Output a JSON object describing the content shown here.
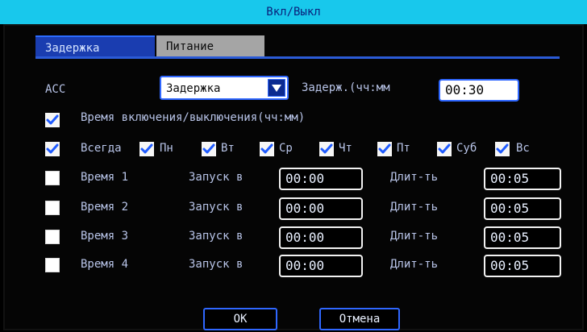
{
  "window": {
    "title": "Вкл/Выкл"
  },
  "tabs": [
    {
      "label": "Задержка"
    },
    {
      "label": "Питание"
    }
  ],
  "acc": {
    "label": "ACC",
    "dropdown_value": "Задержка",
    "delay_label": "Задерж.(чч:мм",
    "delay_value": "00:30"
  },
  "time_onoff": {
    "checked": true,
    "label": "Время включения/выключения(чч:мм)"
  },
  "days": [
    {
      "label": "Всегда",
      "checked": true
    },
    {
      "label": "Пн",
      "checked": true
    },
    {
      "label": "Вт",
      "checked": true
    },
    {
      "label": "Ср",
      "checked": true
    },
    {
      "label": "Чт",
      "checked": true
    },
    {
      "label": "Пт",
      "checked": true
    },
    {
      "label": "Суб",
      "checked": true
    },
    {
      "label": "Вс",
      "checked": true
    }
  ],
  "times": [
    {
      "checked": false,
      "label": "Время 1",
      "start_label": "Запуск в",
      "start_value": "00:00",
      "duration_label": "Длит-ть",
      "duration_value": "00:05"
    },
    {
      "checked": false,
      "label": "Время 2",
      "start_label": "Запуск в",
      "start_value": "00:00",
      "duration_label": "Длит-ть",
      "duration_value": "00:05"
    },
    {
      "checked": false,
      "label": "Время 3",
      "start_label": "Запуск в",
      "start_value": "00:00",
      "duration_label": "Длит-ть",
      "duration_value": "00:05"
    },
    {
      "checked": false,
      "label": "Время 4",
      "start_label": "Запуск в",
      "start_value": "00:00",
      "duration_label": "Длит-ть",
      "duration_value": "00:05"
    }
  ],
  "buttons": {
    "ok": "OK",
    "cancel": "Отмена"
  },
  "colors": {
    "title_bg": "#18c8ec",
    "accent_blue": "#2f67ff",
    "tab_active_bg": "#1a3db0",
    "tab_inactive_bg": "#a5a5a5",
    "text": "#b8c4e8"
  }
}
